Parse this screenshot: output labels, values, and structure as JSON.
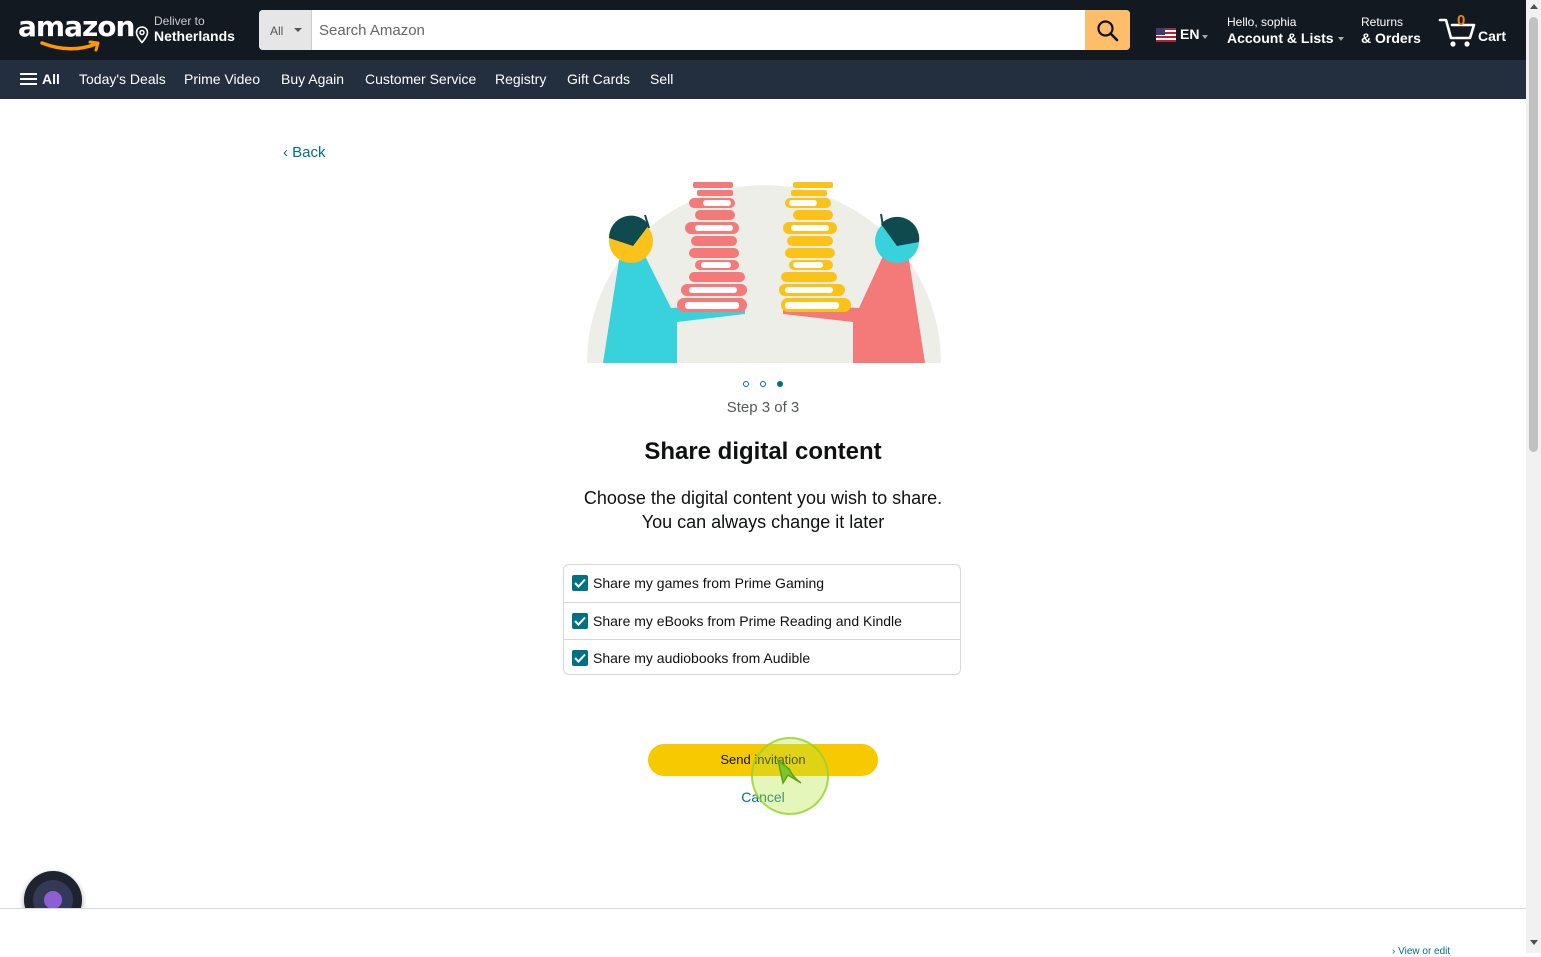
{
  "header": {
    "logo_text": "amazon",
    "deliver_line1": "Deliver to",
    "deliver_line2": "Netherlands",
    "search_category": "All",
    "search_placeholder": "Search Amazon",
    "language": "EN",
    "account_line1": "Hello, sophia",
    "account_line2": "Account & Lists",
    "returns_line1": "Returns",
    "returns_line2": "& Orders",
    "cart_count": "0",
    "cart_label": "Cart"
  },
  "subnav": {
    "items": [
      "All",
      "Today's Deals",
      "Prime Video",
      "Buy Again",
      "Customer Service",
      "Registry",
      "Gift Cards",
      "Sell"
    ]
  },
  "main": {
    "back_link": "‹ Back",
    "steps_total": 3,
    "steps_current": 3,
    "step_text": "Step 3 of 3",
    "title": "Share digital content",
    "description_line1": "Choose the digital content you wish to share.",
    "description_line2": "You can always change it later",
    "options": [
      {
        "label": "Share my games from Prime Gaming",
        "checked": true
      },
      {
        "label": "Share my eBooks from Prime Reading and Kindle",
        "checked": true
      },
      {
        "label": "Share my audiobooks from Audible",
        "checked": true
      }
    ],
    "send_button": "Send invitation",
    "cancel_link": "Cancel"
  },
  "footer": {
    "view_edit_link": "› View or edit"
  },
  "colors": {
    "nav_dark": "#131921",
    "subnav": "#232f3e",
    "search_button": "#febd69",
    "primary_button": "#f7ca00",
    "link": "#007185",
    "checkbox": "#007185",
    "cart_count": "#f08804",
    "illustration_red": "#f47a7a",
    "illustration_yellow": "#fbc21a",
    "illustration_cyan": "#38d2dc"
  },
  "icons": [
    "location-pin-icon",
    "search-icon",
    "us-flag-icon",
    "cart-icon",
    "hamburger-icon",
    "checkmark-icon",
    "cursor-arrow-icon",
    "assistant-orb-icon"
  ]
}
